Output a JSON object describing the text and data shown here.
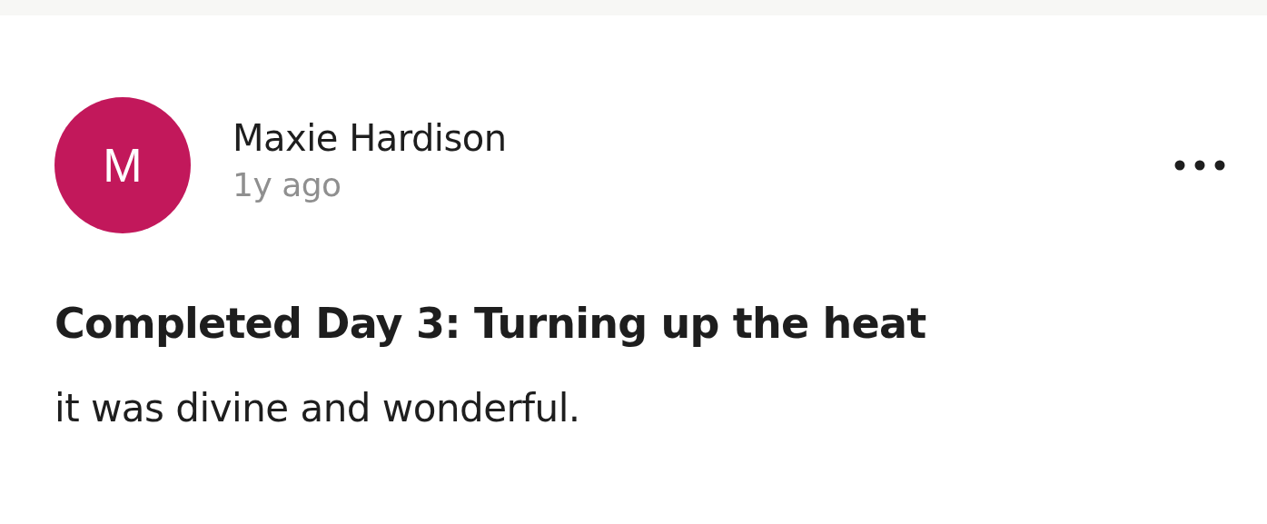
{
  "post": {
    "author": {
      "initial": "M",
      "name": "Maxie Hardison",
      "color": "#c2185b"
    },
    "time": "1y ago",
    "title": "Completed Day 3: Turning up the heat",
    "body": "it was divine and wonderful."
  }
}
